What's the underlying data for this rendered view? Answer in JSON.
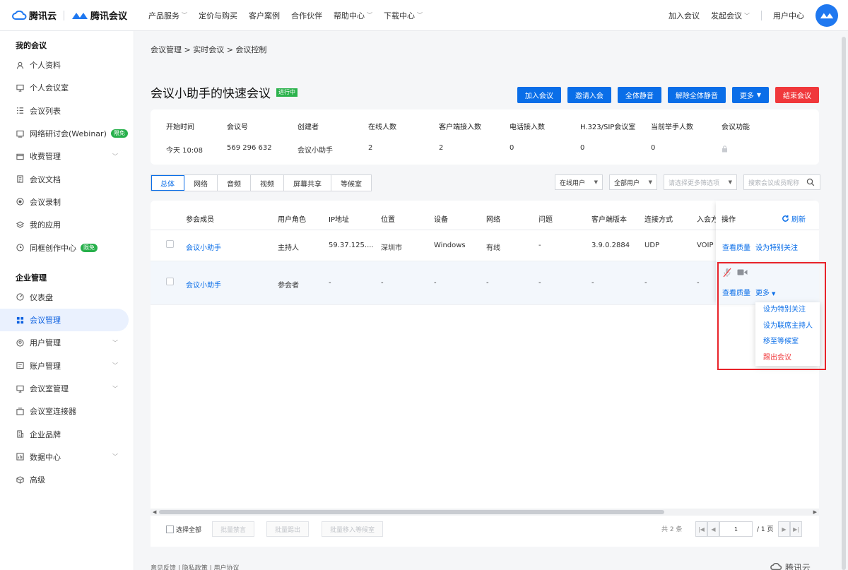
{
  "header": {
    "brand_tencent_cloud": "腾讯云",
    "brand_meeting": "腾讯会议",
    "nav": [
      "产品服务",
      "定价与购买",
      "客户案例",
      "合作伙伴",
      "帮助中心",
      "下载中心"
    ],
    "right": {
      "join": "加入会议",
      "start": "发起会议",
      "user_center": "用户中心"
    }
  },
  "sidebar": {
    "section_my": "我的会议",
    "my_items": [
      {
        "label": "个人资料"
      },
      {
        "label": "个人会议室"
      },
      {
        "label": "会议列表"
      },
      {
        "label": "网络研讨会(Webinar)",
        "badge": "限免"
      },
      {
        "label": "收费管理"
      },
      {
        "label": "会议文档"
      },
      {
        "label": "会议录制"
      },
      {
        "label": "我的应用"
      },
      {
        "label": "同框创作中心",
        "badge": "限免"
      }
    ],
    "section_ent": "企业管理",
    "ent_items": [
      {
        "label": "仪表盘"
      },
      {
        "label": "会议管理"
      },
      {
        "label": "用户管理"
      },
      {
        "label": "账户管理"
      },
      {
        "label": "会议室管理"
      },
      {
        "label": "会议室连接器"
      },
      {
        "label": "企业品牌"
      },
      {
        "label": "数据中心"
      },
      {
        "label": "高级"
      }
    ]
  },
  "breadcrumb": "会议管理 > 实时会议 > 会议控制",
  "meeting": {
    "title": "会议小助手的快速会议",
    "status": "进行中",
    "actions": {
      "join": "加入会议",
      "invite": "邀请入会",
      "mute_all": "全体静音",
      "unmute_all": "解除全体静音",
      "more": "更多",
      "end": "结束会议"
    },
    "info": [
      {
        "label": "开始时间",
        "value": "今天  10:08"
      },
      {
        "label": "会议号",
        "value": "569 296 632"
      },
      {
        "label": "创建者",
        "value": "会议小助手"
      },
      {
        "label": "在线人数",
        "value": "2"
      },
      {
        "label": "客户端接入数",
        "value": "2"
      },
      {
        "label": "电话接入数",
        "value": "0"
      },
      {
        "label": "H.323/SIP会议室",
        "value": "0"
      },
      {
        "label": "当前举手人数",
        "value": "0"
      },
      {
        "label": "会议功能",
        "value": ""
      }
    ]
  },
  "tabs": [
    "总体",
    "网络",
    "音频",
    "视频",
    "屏幕共享",
    "等候室"
  ],
  "filters": {
    "online_user": "在线用户",
    "all_users": "全部用户",
    "more_filter_placeholder": "请选择更多筛选项",
    "search_placeholder": "搜索会议成员昵称"
  },
  "table": {
    "columns": [
      "参会成员",
      "用户角色",
      "IP地址",
      "位置",
      "设备",
      "网络",
      "问题",
      "客户端版本",
      "连接方式",
      "入会方式",
      "操作"
    ],
    "refresh": "刷新",
    "rows": [
      {
        "member": "会议小助手",
        "role": "主持人",
        "ip": "59.37.125....",
        "location": "深圳市",
        "device": "Windows",
        "network": "有线",
        "issue": "-",
        "version": "3.9.0.2884",
        "connection": "UDP",
        "join_type": "VOIP",
        "op1": "查看质量",
        "op2": "设为特别关注"
      },
      {
        "member": "会议小助手",
        "role": "参会者",
        "ip": "-",
        "location": "-",
        "device": "-",
        "network": "-",
        "issue": "-",
        "version": "-",
        "connection": "-",
        "join_type": "-",
        "op1": "查看质量",
        "op2": "更多"
      }
    ],
    "more_menu": [
      "设为特别关注",
      "设为联席主持人",
      "移至等候室",
      "踢出会议"
    ]
  },
  "footer": {
    "select_all": "选择全部",
    "batch_mute": "批量禁言",
    "batch_remove": "批量踢出",
    "batch_waiting": "批量移入等候室",
    "total": "共 2 条",
    "page": "1",
    "pages": "/ 1 页"
  },
  "page_footer": "意见反馈 | 隐私政策 | 用户协议",
  "footer_logo": "腾讯云",
  "colors": {
    "primary": "#0a6ee8",
    "danger": "#f0383b",
    "status_green": "#2bb24c",
    "highlight_red": "#e8232a"
  }
}
